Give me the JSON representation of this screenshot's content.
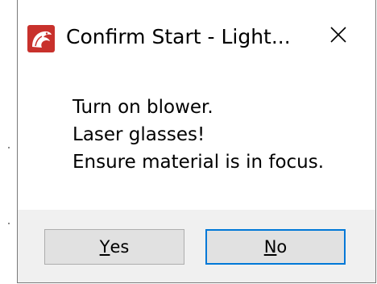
{
  "dialog": {
    "title": "Confirm Start - Light...",
    "icon": "lightburn-app-icon",
    "close_icon": "close-x-icon"
  },
  "message": {
    "lines": [
      "Turn on blower.",
      "Laser glasses!",
      "Ensure material is in focus."
    ]
  },
  "buttons": {
    "yes": {
      "mnemonic": "Y",
      "rest": "es"
    },
    "no": {
      "mnemonic": "N",
      "rest": "o"
    }
  },
  "colors": {
    "accent_focus_border": "#0078d7",
    "footer_background": "#f0f0f0",
    "icon_red": "#c8312c"
  }
}
